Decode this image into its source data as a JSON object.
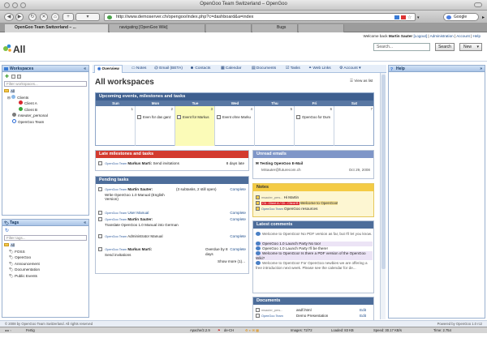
{
  "window": {
    "title": "OpenGoo Team Switzerland – OpenGoo"
  },
  "browser": {
    "url": "http://www.demoserver.ch/opengoo/index.php?c=dashboard&a=index",
    "search_engine": "Google",
    "tabs": [
      {
        "label": "OpenGoo Team Switzerland – ..."
      },
      {
        "label": "navigating [OpenGoo Wiki]"
      },
      {
        "label": ""
      },
      {
        "label": "Bugs"
      },
      {
        "label": ""
      }
    ],
    "status": {
      "left": "Fertig",
      "server": "Apache/2.2.9",
      "locale": "de-CH",
      "images": "Images: 72/72",
      "loaded": "Loaded: 83 KB",
      "speed": "Speed: 30.17 KB/s",
      "time": "Time: 2.754"
    }
  },
  "app": {
    "logo": "All",
    "welcome": {
      "prefix": "Welcome back",
      "user": "Martin Sauter",
      "logout": "[Logout]",
      "admin": "Administration",
      "account": "Account",
      "help": "Help"
    },
    "search_placeholder": "Search...",
    "search_button": "Search",
    "new_button": "New"
  },
  "workspaces": {
    "title": "Workspaces",
    "filter_placeholder": "Filter workspaces...",
    "items": [
      "All",
      "Clients",
      "Client A",
      "Client B",
      "mseuter_personal",
      "OpenGoo Team"
    ],
    "colors": {
      "client_a": "#d9262e",
      "client_b": "#39a63b",
      "personal": "#7b7b7b",
      "team": "#2a6bd6"
    }
  },
  "tags": {
    "title": "Tags",
    "filter_placeholder": "Filter tags...",
    "items": [
      "All",
      "FOSS",
      "OpenGoo",
      "Announcement",
      "Documentation",
      "Public Events"
    ]
  },
  "help": {
    "title": "Help"
  },
  "tabs": [
    "Overview",
    "Notes",
    "Email (BETA)",
    "Contacts",
    "Calendar",
    "Documents",
    "Tasks",
    "Web Links",
    "Account"
  ],
  "main": {
    "title": "All workspaces",
    "view_as_list": "View as list"
  },
  "calendar": {
    "title": "Upcoming events, milestones and tasks",
    "days": [
      "Sun",
      "Mon",
      "Tue",
      "Wed",
      "Thu",
      "Fri",
      "Sat"
    ],
    "dates": [
      "1",
      "2",
      "3",
      "4",
      "5",
      "6",
      "7",
      "8"
    ],
    "events": {
      "mon": "Even für das ganz",
      "tue": "Event für Markus",
      "wed": "Event ohne Marku",
      "fri": "OpenGoo for Dum"
    }
  },
  "late": {
    "title": "Late milestones and tasks",
    "row": {
      "ws": "OpenGoo Team",
      "user": "Markus Marti:",
      "text": "Send invitations",
      "due": "8 days late"
    }
  },
  "pending": {
    "title": "Pending tasks",
    "rows": [
      {
        "ws": "OpenGoo Team",
        "user": "Martin Sauter:",
        "text": "Write OpenGoo 1.0 Manual (English Version)",
        "extra": "(3 subtasks, 2 still open)",
        "status": "Complete"
      },
      {
        "ws": "OpenGoo Team",
        "user": "",
        "text": "User Manual",
        "extra": "",
        "status": "Complete"
      },
      {
        "ws": "OpenGoo Team",
        "user": "Martin Sauter:",
        "text": "Translate OpenGoo 1.0 Manual into German",
        "extra": "",
        "status": "Complete"
      },
      {
        "ws": "OpenGoo Team",
        "user": "",
        "text": "Administrator Manual",
        "extra": "",
        "status": "Complete"
      },
      {
        "ws": "OpenGoo Team",
        "user": "Markus Marti:",
        "text": "Send invitations",
        "extra": "Overdue by 8 days",
        "status": "Complete"
      }
    ],
    "show_more": "Show more (1)..."
  },
  "unread": {
    "title": "Unread emails",
    "subject": "Testing OpenGoo E-Mail",
    "from": "MSauter@futurecom.ch",
    "date": "Oct 29, 2008"
  },
  "notes": {
    "title": "Notes",
    "rows": [
      {
        "ws": "msauter_pers...",
        "text": "Hi Martin"
      },
      {
        "ws": "Cli...Client A / Cli...Client B",
        "text": "Welcome to OpenGoo!"
      },
      {
        "ws": "OpenGoo Team",
        "text": "OpenGoo resources"
      }
    ]
  },
  "comments": {
    "title": "Latest comments",
    "items": [
      "Welcome to OpenGoo! No PDF version as far, but I'll let you know.",
      "OpenGoo 1.0 Launch Party No too!",
      "OpenGoo 1.0 Launch Party I'll be there!",
      "Welcome to OpenGoo! Is there a PDF version of the OpenGoo Wiki?",
      "Welcome to OpenGoo! For OpenGoo newbies we are offering a free introduction next week. Please see the calendar for de..."
    ]
  },
  "documents": {
    "title": "Documents",
    "rows": [
      {
        "ws": "msauter_pers...",
        "name": "asdf.html",
        "action": "Edit"
      },
      {
        "ws": "OpenGoo Team",
        "name": "Demo Presentation",
        "action": "Edit"
      }
    ]
  },
  "footer": {
    "copyright": "© 2008 by OpenGoo Team Switzerland. All rights reserved",
    "powered": "Powered by OpenGoo 1.0 rc2"
  },
  "colors": {
    "late_header": "#d33a2f",
    "pending_header": "#4d6d9a",
    "unread_header": "#7f96c8",
    "notes_header": "#f4cb45",
    "comments_header": "#4d6d9a",
    "documents_header": "#4d6d9a"
  }
}
